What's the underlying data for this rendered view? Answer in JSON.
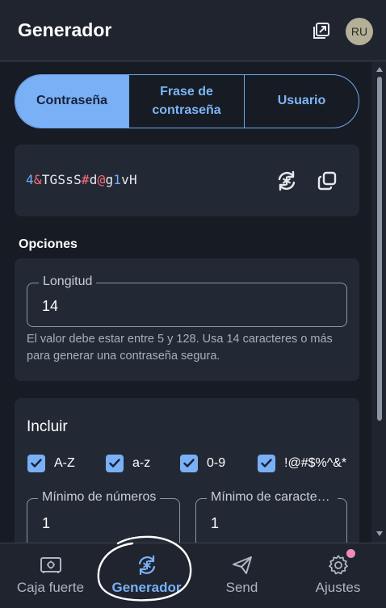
{
  "header": {
    "title": "Generador",
    "popout_icon": "popout-icon",
    "avatar_initials": "RU"
  },
  "tabs": {
    "items": [
      {
        "label": "Contraseña",
        "active": true
      },
      {
        "label": "Frase de contraseña",
        "active": false
      },
      {
        "label": "Usuario",
        "active": false
      }
    ]
  },
  "password": {
    "value": "4&TGSsS#d@g1vH",
    "regenerate_icon": "regenerate-icon",
    "copy_icon": "copy-icon",
    "colors": {
      "number": "#6fb0ff",
      "symbol": "#ff6b7a",
      "letter": "#e6e9ef"
    }
  },
  "options": {
    "title": "Opciones",
    "length_label": "Longitud",
    "length_value": "14",
    "hint": "El valor debe estar entre 5 y 128. Usa 14 caracteres o más para generar una contraseña segura."
  },
  "include": {
    "title": "Incluir",
    "checkboxes": [
      {
        "label": "A-Z",
        "checked": true
      },
      {
        "label": "a-z",
        "checked": true
      },
      {
        "label": "0-9",
        "checked": true
      },
      {
        "label": "!@#$%^&*",
        "checked": true
      }
    ],
    "min_numbers_label": "Mínimo de números",
    "min_numbers_value": "1",
    "min_special_label": "Mínimo de caracteres especiales",
    "min_special_value": "1"
  },
  "nav": {
    "items": [
      {
        "label": "Caja fuerte",
        "icon": "vault-icon",
        "active": false
      },
      {
        "label": "Generador",
        "icon": "generator-icon",
        "active": true
      },
      {
        "label": "Send",
        "icon": "send-icon",
        "active": false
      },
      {
        "label": "Ajustes",
        "icon": "gear-icon",
        "active": false
      }
    ]
  },
  "accent_color": "#79b0f6"
}
